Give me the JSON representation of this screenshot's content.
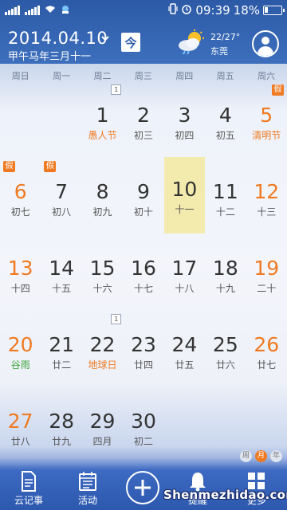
{
  "status": {
    "time": "09:39",
    "battery": "18%"
  },
  "header": {
    "date": "2014.04.10",
    "lunar": "甲午马年三月十一",
    "today_label": "今",
    "temp": "22/27°",
    "location": "东莞",
    "weather_icon": "partly-cloudy-rain-icon"
  },
  "weekdays": [
    "周日",
    "周一",
    "周二",
    "周三",
    "周四",
    "周五",
    "周六"
  ],
  "days": [
    {
      "n": "1",
      "lunar": "愚人节",
      "fest": true,
      "badge": "1",
      "row": 0,
      "col": 2
    },
    {
      "n": "2",
      "lunar": "初三",
      "row": 0,
      "col": 3
    },
    {
      "n": "3",
      "lunar": "初四",
      "row": 0,
      "col": 4
    },
    {
      "n": "4",
      "lunar": "初五",
      "row": 0,
      "col": 5
    },
    {
      "n": "5",
      "lunar": "清明节",
      "fest": true,
      "weekend": true,
      "jia": "假",
      "row": 0,
      "col": 6
    },
    {
      "n": "6",
      "lunar": "初七",
      "weekend": true,
      "jia": "假",
      "row": 1,
      "col": 0
    },
    {
      "n": "7",
      "lunar": "初八",
      "jia": "假",
      "row": 1,
      "col": 1
    },
    {
      "n": "8",
      "lunar": "初九",
      "row": 1,
      "col": 2
    },
    {
      "n": "9",
      "lunar": "初十",
      "row": 1,
      "col": 3
    },
    {
      "n": "10",
      "lunar": "十一",
      "today": true,
      "row": 1,
      "col": 4
    },
    {
      "n": "11",
      "lunar": "十二",
      "row": 1,
      "col": 5
    },
    {
      "n": "12",
      "lunar": "十三",
      "weekend": true,
      "row": 1,
      "col": 6
    },
    {
      "n": "13",
      "lunar": "十四",
      "weekend": true,
      "row": 2,
      "col": 0
    },
    {
      "n": "14",
      "lunar": "十五",
      "row": 2,
      "col": 1
    },
    {
      "n": "15",
      "lunar": "十六",
      "row": 2,
      "col": 2
    },
    {
      "n": "16",
      "lunar": "十七",
      "row": 2,
      "col": 3
    },
    {
      "n": "17",
      "lunar": "十八",
      "row": 2,
      "col": 4
    },
    {
      "n": "18",
      "lunar": "十九",
      "row": 2,
      "col": 5
    },
    {
      "n": "19",
      "lunar": "二十",
      "weekend": true,
      "row": 2,
      "col": 6
    },
    {
      "n": "20",
      "lunar": "谷雨",
      "term": true,
      "weekend": true,
      "row": 3,
      "col": 0
    },
    {
      "n": "21",
      "lunar": "廿二",
      "row": 3,
      "col": 1
    },
    {
      "n": "22",
      "lunar": "地球日",
      "fest": true,
      "badge": "1",
      "row": 3,
      "col": 2
    },
    {
      "n": "23",
      "lunar": "廿四",
      "row": 3,
      "col": 3
    },
    {
      "n": "24",
      "lunar": "廿五",
      "row": 3,
      "col": 4
    },
    {
      "n": "25",
      "lunar": "廿六",
      "row": 3,
      "col": 5
    },
    {
      "n": "26",
      "lunar": "廿七",
      "weekend": true,
      "row": 3,
      "col": 6
    },
    {
      "n": "27",
      "lunar": "廿八",
      "weekend": true,
      "row": 4,
      "col": 0
    },
    {
      "n": "28",
      "lunar": "廿九",
      "row": 4,
      "col": 1
    },
    {
      "n": "29",
      "lunar": "四月",
      "row": 4,
      "col": 2
    },
    {
      "n": "30",
      "lunar": "初二",
      "row": 4,
      "col": 3
    }
  ],
  "view_toggle": [
    "周",
    "月",
    "年"
  ],
  "bottom": {
    "notes": "云记事",
    "activity": "活动",
    "reminder": "提醒",
    "more": "更多"
  },
  "watermark": "Shenmezhidao.com",
  "colors": {
    "accent": "#ef7a22",
    "header": "#2c5aa6",
    "today_bg": "#f2ebad",
    "solar_term": "#3aa33a"
  }
}
